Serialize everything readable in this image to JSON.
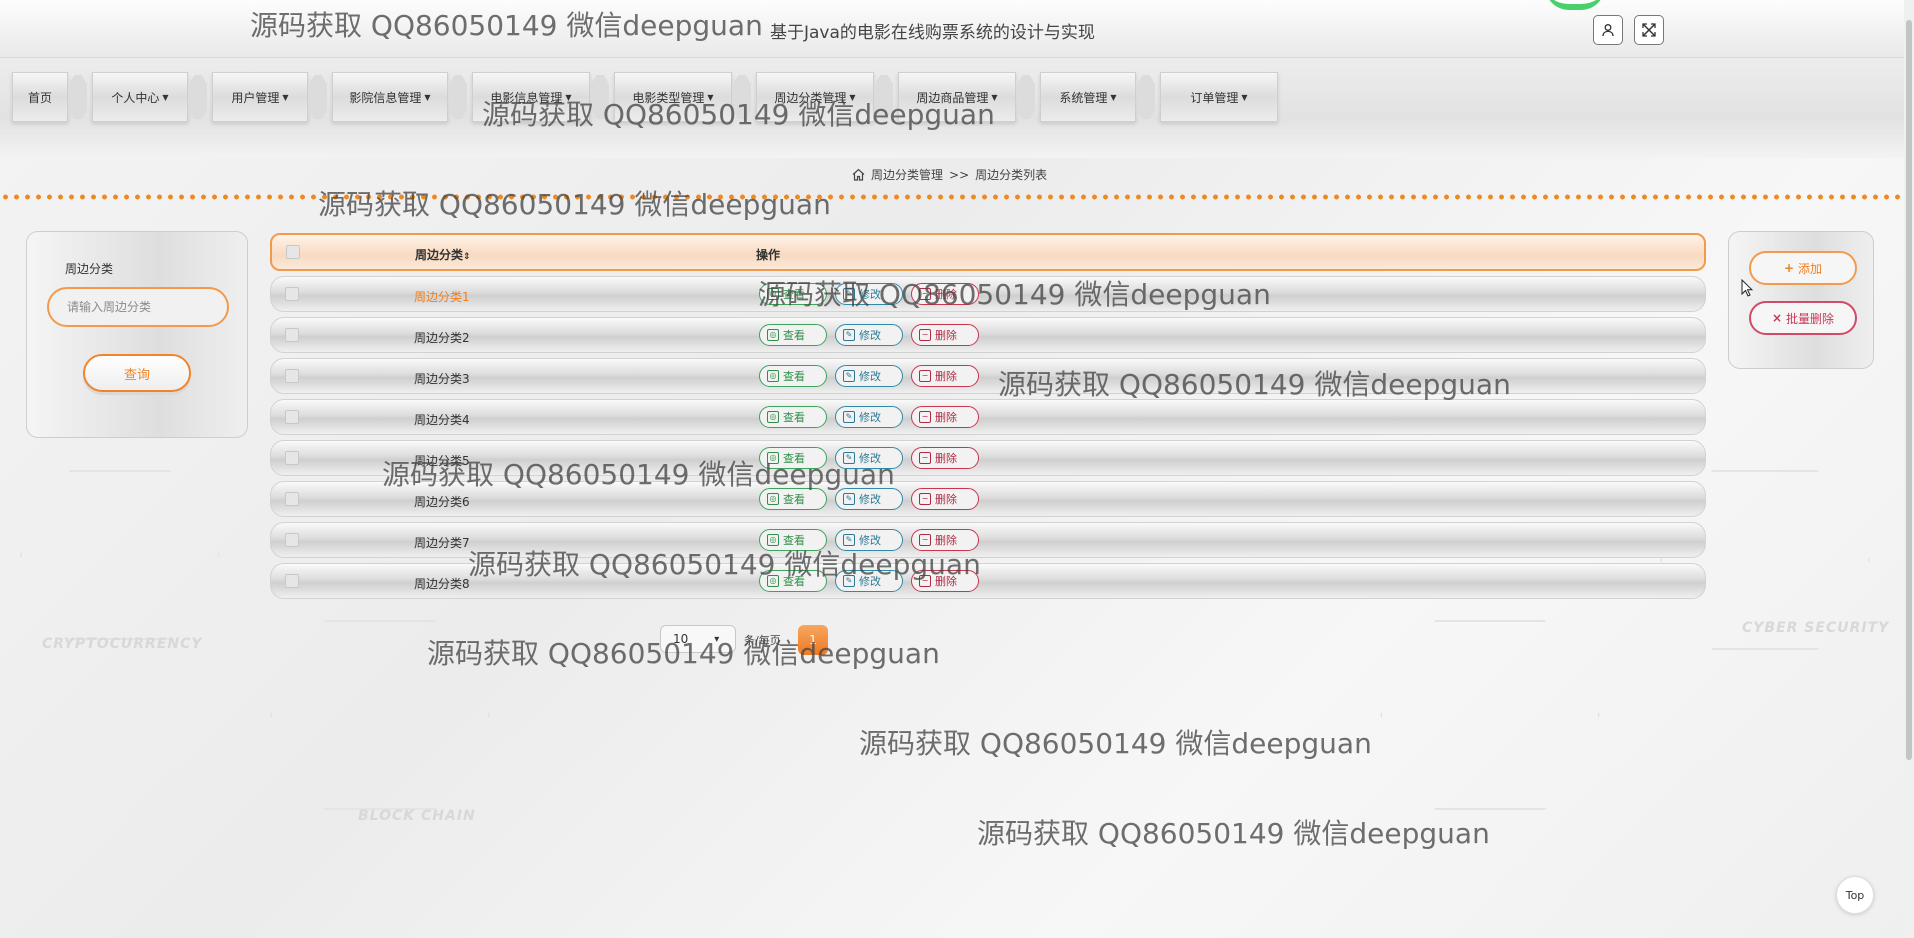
{
  "header": {
    "site_title": "基于Java的电影在线购票系统的设计与实现"
  },
  "nav": {
    "items": [
      {
        "label": "首页",
        "has_caret": false
      },
      {
        "label": "个人中心",
        "has_caret": true
      },
      {
        "label": "用户管理",
        "has_caret": true
      },
      {
        "label": "影院信息管理",
        "has_caret": true
      },
      {
        "label": "电影信息管理",
        "has_caret": true
      },
      {
        "label": "电影类型管理",
        "has_caret": true
      },
      {
        "label": "周边分类管理",
        "has_caret": true
      },
      {
        "label": "周边商品管理",
        "has_caret": true
      },
      {
        "label": "系统管理",
        "has_caret": true
      },
      {
        "label": "订单管理",
        "has_caret": true
      }
    ]
  },
  "breadcrumb": {
    "home_icon": "home-icon",
    "parent": "周边分类管理",
    "separator": ">>",
    "current": "周边分类列表"
  },
  "search": {
    "label": "周边分类",
    "placeholder": "请输入周边分类",
    "button": "查询"
  },
  "actions": {
    "add_label": "添加",
    "batch_delete_label": "批量删除"
  },
  "table": {
    "columns": [
      "周边分类",
      "操作"
    ],
    "sort_icon": "sort-icon",
    "rows": [
      {
        "name": "周边分类1"
      },
      {
        "name": "周边分类2"
      },
      {
        "name": "周边分类3"
      },
      {
        "name": "周边分类4"
      },
      {
        "name": "周边分类5"
      },
      {
        "name": "周边分类6"
      },
      {
        "name": "周边分类7"
      },
      {
        "name": "周边分类8"
      }
    ],
    "row_actions": {
      "view": "查看",
      "edit": "修改",
      "delete": "删除"
    }
  },
  "pagination": {
    "page_size": "10",
    "per_page_label": "条/每页",
    "current_page": "1"
  },
  "watermark": "源码获取 QQ86050149 微信deepguan",
  "background_labels": [
    "CRYPTOCURRENCY",
    "BLOCK CHAIN",
    "CYBER SECURITY"
  ],
  "top_button": "Top",
  "colors": {
    "accent": "#f0862b",
    "view": "#2e8f49",
    "edit": "#2a7a96",
    "delete": "#b02a43"
  }
}
